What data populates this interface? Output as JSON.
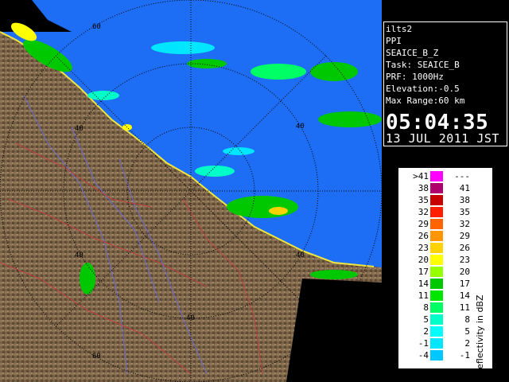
{
  "info": {
    "lines": [
      "ilts2",
      "PPI",
      "SEAICE_B_Z",
      "Task: SEAICE_B",
      "PRF: 1000Hz",
      "Elevation:-0.5",
      "Max Range:60 km"
    ],
    "time": "05:04:35",
    "date": "13 JUL 2011 JST"
  },
  "range_labels": [
    "60",
    "40",
    "40",
    "40",
    "40",
    "60"
  ],
  "legend": {
    "title": "Reflectivity in dBZ",
    "rows": [
      {
        "left": ">41",
        "right": "---",
        "color": "#ff00ff"
      },
      {
        "left": "38",
        "right": "41",
        "color": "#b0006e"
      },
      {
        "left": "35",
        "right": "38",
        "color": "#c80000"
      },
      {
        "left": "32",
        "right": "35",
        "color": "#ff1e00"
      },
      {
        "left": "29",
        "right": "32",
        "color": "#ff6400"
      },
      {
        "left": "26",
        "right": "29",
        "color": "#ff9600"
      },
      {
        "left": "23",
        "right": "26",
        "color": "#ffd200"
      },
      {
        "left": "20",
        "right": "23",
        "color": "#ffff00"
      },
      {
        "left": "17",
        "right": "20",
        "color": "#96ff00"
      },
      {
        "left": "14",
        "right": "17",
        "color": "#00c800"
      },
      {
        "left": "11",
        "right": "14",
        "color": "#00e600"
      },
      {
        "left": "8",
        "right": "11",
        "color": "#00ff64"
      },
      {
        "left": "5",
        "right": "8",
        "color": "#00ffc8"
      },
      {
        "left": "2",
        "right": "5",
        "color": "#00ffff"
      },
      {
        "left": "-1",
        "right": "2",
        "color": "#00e6ff"
      },
      {
        "left": "-4",
        "right": "-1",
        "color": "#00c8ff"
      }
    ]
  },
  "colors": {
    "sea": "#1e6ef5",
    "land": "#7a6246",
    "background": "#000000",
    "range_ring": "#000000"
  }
}
